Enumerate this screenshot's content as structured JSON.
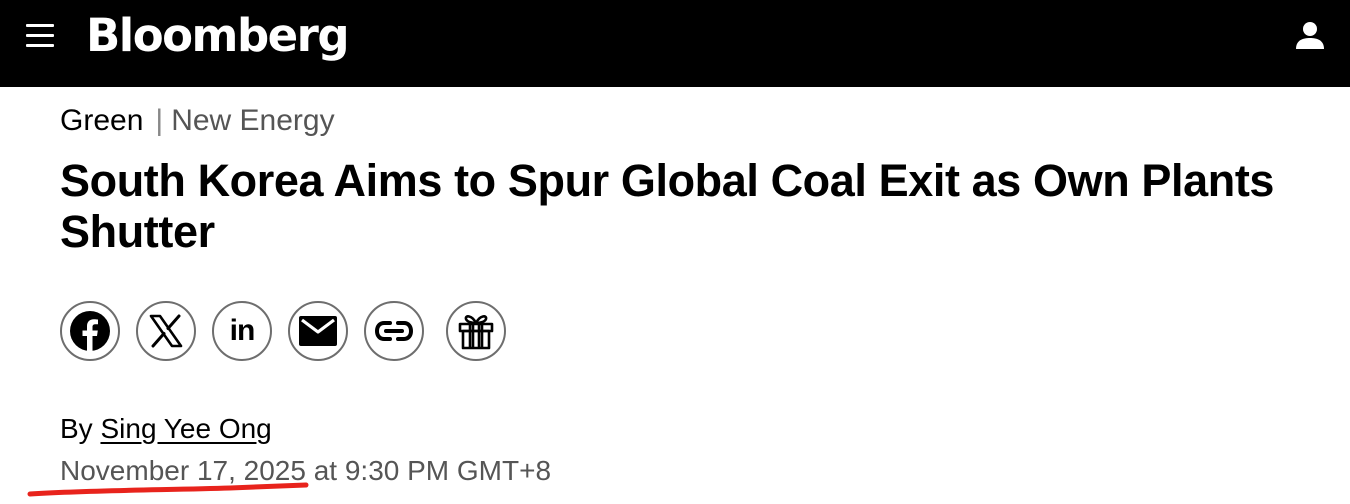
{
  "header": {
    "logo": "Bloomberg",
    "menu_icon": "hamburger-menu-icon",
    "account_icon": "user-icon"
  },
  "article": {
    "category": "Green",
    "separator": "|",
    "subcategory": "New Energy",
    "headline": "South Korea Aims to Spur Global Coal Exit as Own Plants Shutter",
    "share_buttons": [
      {
        "icon": "facebook-icon"
      },
      {
        "icon": "x-icon"
      },
      {
        "icon": "linkedin-icon",
        "text": "in"
      },
      {
        "icon": "email-icon"
      },
      {
        "icon": "link-icon"
      },
      {
        "icon": "gift-icon"
      }
    ],
    "byline_prefix": "By",
    "author": "Sing Yee Ong",
    "date": "November 17, 2025",
    "time": " at 9:30 PM GMT+8"
  },
  "colors": {
    "header_bg": "#000000",
    "annotation": "#e8231c",
    "meta_text": "#555555"
  }
}
